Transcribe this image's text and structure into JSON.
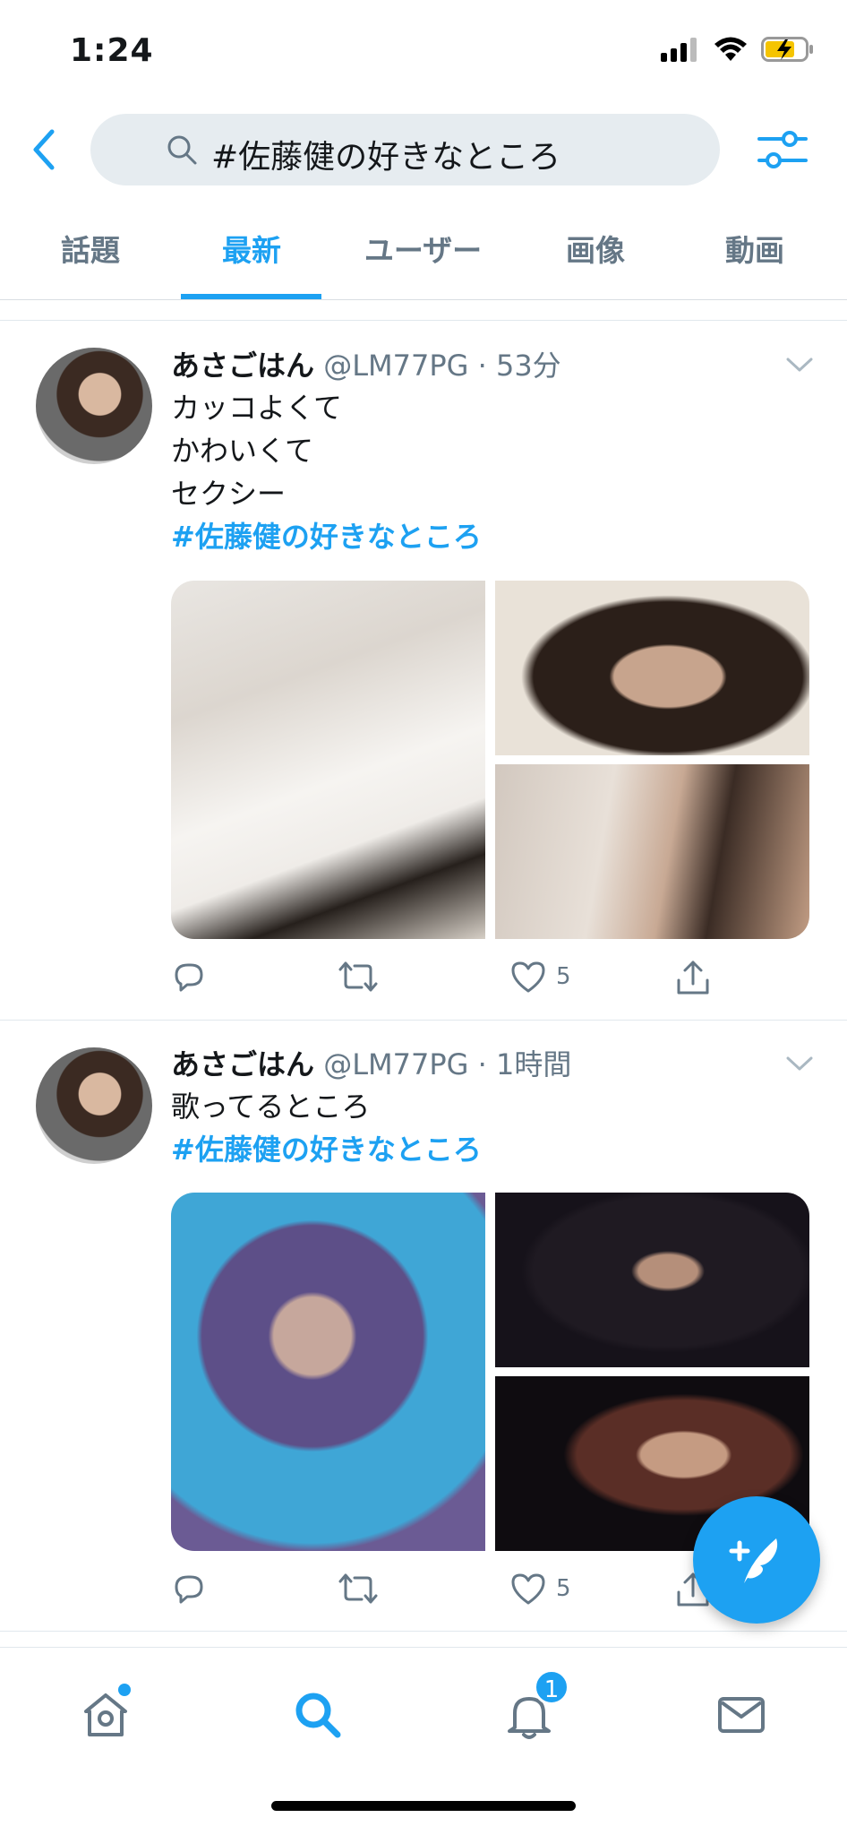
{
  "status_bar": {
    "time": "1:24",
    "icons": [
      "cellular-signal-icon",
      "wifi-icon",
      "battery-charging-icon"
    ]
  },
  "search": {
    "query": "#佐藤健の好きなところ",
    "back_icon": "chevron-left-icon",
    "search_icon": "search-icon",
    "filter_icon": "sliders-icon"
  },
  "tabs": [
    {
      "label": "話題",
      "active": false
    },
    {
      "label": "最新",
      "active": true
    },
    {
      "label": "ユーザー",
      "active": false
    },
    {
      "label": "画像",
      "active": false
    },
    {
      "label": "動画",
      "active": false
    }
  ],
  "tweets": [
    {
      "display_name": "あさごはん",
      "handle_time": "@LM77PG · 53分",
      "lines": [
        "カッコよくて",
        "かわいくて",
        "セクシー"
      ],
      "hashtag": "#佐藤健の好きなところ",
      "like_count": "5"
    },
    {
      "display_name": "あさごはん",
      "handle_time": "@LM77PG · 1時間",
      "lines": [
        "歌ってるところ"
      ],
      "hashtag": "#佐藤健の好きなところ",
      "like_count": "5"
    }
  ],
  "bottom_nav": {
    "items": [
      "home-icon",
      "search-icon",
      "notifications-icon",
      "messages-icon"
    ],
    "notification_badge": "1"
  },
  "colors": {
    "accent": "#1da1f2",
    "secondary_text": "#657786",
    "search_bg": "#e6ecf0"
  }
}
